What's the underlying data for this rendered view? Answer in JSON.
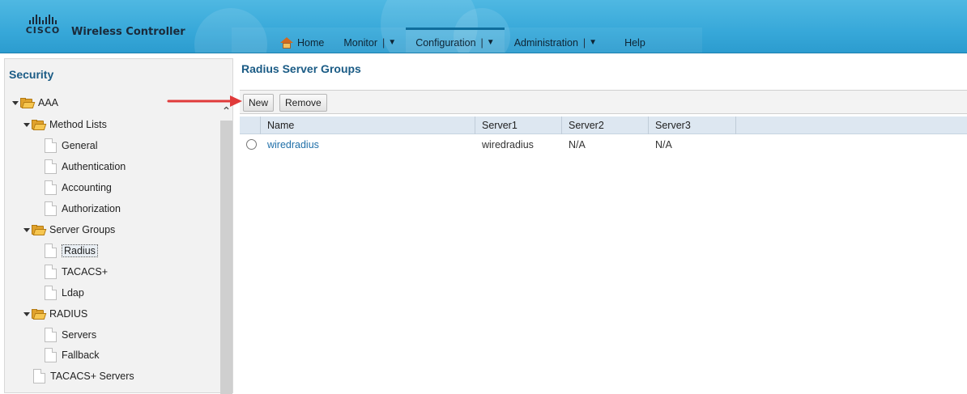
{
  "header": {
    "logo_text": "CISCO",
    "app_title": "Wireless Controller",
    "nav": [
      {
        "label": "Home",
        "icon": "home-icon",
        "dropdown": false
      },
      {
        "label": "Monitor",
        "dropdown": true
      },
      {
        "label": "Configuration",
        "dropdown": true,
        "active": true
      },
      {
        "label": "Administration",
        "dropdown": true
      },
      {
        "label": "Help",
        "dropdown": false
      }
    ]
  },
  "sidebar": {
    "title": "Security",
    "items": [
      {
        "label": "AAA",
        "type": "folder",
        "expanded": true
      },
      {
        "label": "Method Lists",
        "type": "folder",
        "expanded": true
      },
      {
        "label": "General",
        "type": "page"
      },
      {
        "label": "Authentication",
        "type": "page"
      },
      {
        "label": "Accounting",
        "type": "page"
      },
      {
        "label": "Authorization",
        "type": "page"
      },
      {
        "label": "Server Groups",
        "type": "folder",
        "expanded": true
      },
      {
        "label": "Radius",
        "type": "page",
        "selected": true
      },
      {
        "label": "TACACS+",
        "type": "page"
      },
      {
        "label": "Ldap",
        "type": "page"
      },
      {
        "label": "RADIUS",
        "type": "folder",
        "expanded": true
      },
      {
        "label": "Servers",
        "type": "page"
      },
      {
        "label": "Fallback",
        "type": "page"
      },
      {
        "label": "TACACS+ Servers",
        "type": "page"
      }
    ]
  },
  "main": {
    "title": "Radius Server Groups",
    "toolbar": {
      "new_label": "New",
      "remove_label": "Remove"
    },
    "table": {
      "columns": [
        "Name",
        "Server1",
        "Server2",
        "Server3"
      ],
      "rows": [
        {
          "name": "wiredradius",
          "server1": "wiredradius",
          "server2": "N/A",
          "server3": "N/A"
        }
      ]
    }
  },
  "colors": {
    "header": "#37a8d9",
    "title_blue": "#1a5b85",
    "link_blue": "#1f6fa8",
    "annotation_arrow": "#e03b3b",
    "folder": "#e0a22c"
  }
}
